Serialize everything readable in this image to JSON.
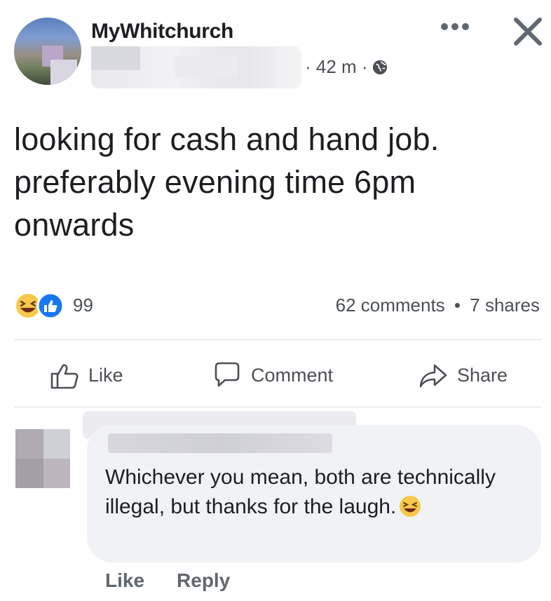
{
  "header": {
    "page_name": "MyWhitchurch",
    "time_ago": "· 42 m ·",
    "icons": [
      "globe-icon",
      "more-icon",
      "close-icon"
    ]
  },
  "post": {
    "text": "looking for cash and hand job. preferably evening time 6pm onwards"
  },
  "reactions": {
    "icons": [
      "haha-reaction-icon",
      "like-reaction-icon"
    ],
    "count": "99",
    "comments": "62 comments",
    "separator": "•",
    "shares": "7 shares"
  },
  "actions": {
    "like": "Like",
    "comment": "Comment",
    "share": "Share"
  },
  "comment": {
    "text": "Whichever you mean, both are technically illegal, but thanks for the laugh.",
    "like": "Like",
    "reply": "Reply"
  },
  "colors": {
    "text": "#1c1e21",
    "secondary": "#4b4f56",
    "like_blue": "#1877f2",
    "haha_yellow": "#f7c84a",
    "bubble": "#f0f2f5"
  }
}
